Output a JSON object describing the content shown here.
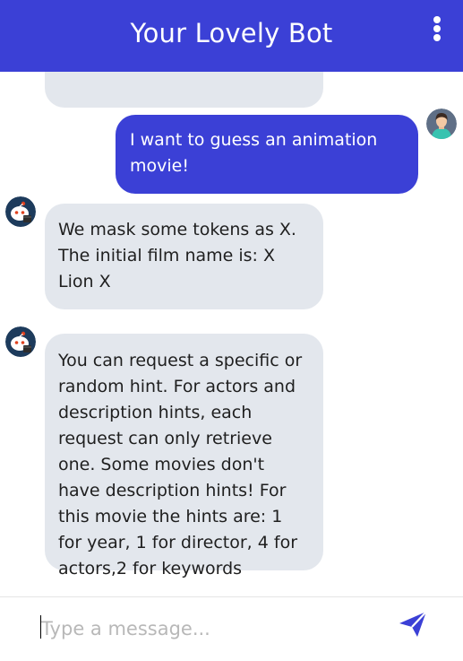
{
  "header": {
    "title": "Your Lovely Bot",
    "menu_icon": "more-vertical-icon"
  },
  "messages": [
    {
      "sender": "bot",
      "text": "",
      "avatar": "none"
    },
    {
      "sender": "user",
      "text": "I want to guess an animation movie!",
      "avatar": "user-avatar-icon"
    },
    {
      "sender": "bot",
      "text": "We mask some tokens as X. The initial film name is: X Lion X",
      "avatar": "bot-avatar-icon"
    },
    {
      "sender": "bot",
      "text": "You can request a specific or random hint. For actors and description hints, each request can only retrieve one. Some movies don't have description hints! For this movie the hints are: 1 for year, 1 for director, 4 for actors,2 for keywords",
      "avatar": "bot-avatar-icon"
    }
  ],
  "composer": {
    "placeholder": "Type a message...",
    "value": "",
    "send_icon": "send-icon"
  },
  "colors": {
    "accent": "#3b40d6",
    "bot_bubble": "#e3e7ed",
    "user_text": "#ffffff",
    "bot_text": "#1f1f1f"
  }
}
